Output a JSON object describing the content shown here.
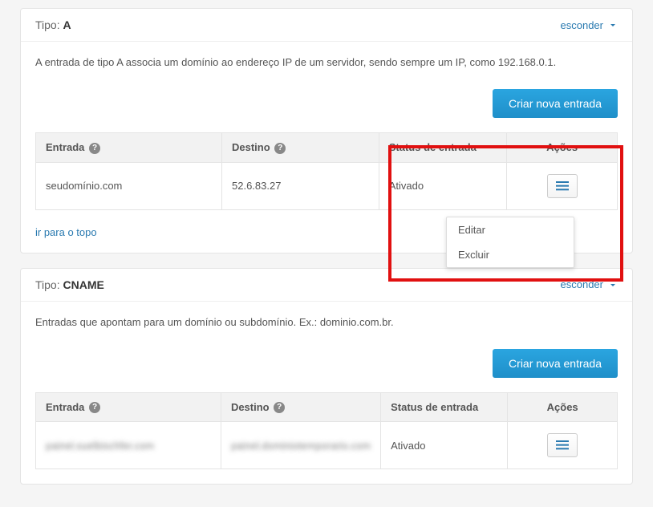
{
  "panels": [
    {
      "type_prefix": "Tipo:",
      "type_value": "A",
      "toggle_label": "esconder",
      "description": "A entrada de tipo A associa um domínio ao endereço IP de um servidor, sendo sempre um IP, como 192.168.0.1.",
      "create_btn_label": "Criar nova entrada",
      "columns": {
        "c1": "Entrada",
        "c2": "Destino",
        "c3": "Status de entrada",
        "c4": "Ações"
      },
      "row": {
        "entry": "seudomínio.com",
        "dest": "52.6.83.27",
        "status": "Ativado"
      },
      "back_to_top": "ir para o topo",
      "dropdown": {
        "edit": "Editar",
        "delete": "Excluir"
      }
    },
    {
      "type_prefix": "Tipo:",
      "type_value": "CNAME",
      "toggle_label": "esconder",
      "description": "Entradas que apontam para um domínio ou subdomínio. Ex.: dominio.com.br.",
      "create_btn_label": "Criar nova entrada",
      "columns": {
        "c1": "Entrada",
        "c2": "Destino",
        "c3": "Status de entrada",
        "c4": "Ações"
      },
      "row": {
        "entry": "painel.suelbischfer.com",
        "dest": "painel.dominiotemporario.com",
        "status": "Ativado"
      }
    }
  ]
}
